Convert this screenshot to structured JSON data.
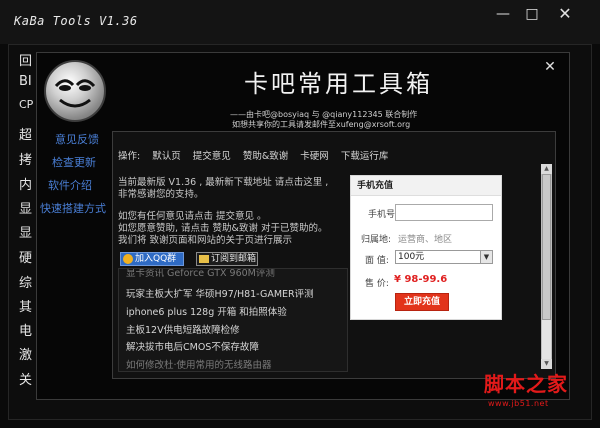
{
  "app": {
    "title": "KaBa Tools V1.36",
    "minimize": "—",
    "maximize": "□",
    "close": "✕"
  },
  "sidebar": {
    "items": [
      "回",
      "BI",
      "CP",
      "超",
      "拷",
      "内",
      "显",
      "显",
      "硬",
      "综",
      "其",
      "电",
      "激",
      "关"
    ]
  },
  "popup": {
    "close": "✕",
    "title": "卡吧常用工具箱",
    "credit_line1": "——由卡吧@bosyiaq 与 @qiany112345 联合制作",
    "credit_line2": "如想共享你的工具请发邮件至xufeng@xrsoft.org",
    "side_links": [
      "意见反馈",
      "检查更新",
      "软件介绍",
      "快速搭建方式"
    ]
  },
  "content": {
    "menu_label": "操作:",
    "menu_items": [
      "默认页",
      "提交意见",
      "赞助&致谢",
      "卡硬网",
      "下载运行库"
    ],
    "lines": [
      "当前最新版 V1.36 ,   最新新下载地址 请点击这里 ,",
      "非常感谢您的支持。",
      "如您有任何意见请点击  提交意见 。",
      "如您愿意赞助, 请点击 赞助&致谢 对于已赞助的。",
      "我们将 致谢页面和网站的关于页进行展示"
    ],
    "qq_button": "加入QQ群",
    "mail_button": "订阅到邮箱"
  },
  "news": {
    "items": [
      "显卡资讯 Geforce GTX 960M评测",
      "玩家主板大扩军 华硕H97/H81-GAMER评测",
      "iphone6 plus 128g 开箱 和拍照体验",
      "主板12V供电短路故障检修",
      "解决拔市电后CMOS不保存故障",
      "如何修改杜·使用常用的无线路由器"
    ]
  },
  "recharge": {
    "header": "手机充值",
    "phone_label": "手机号:",
    "region_label": "归属地:",
    "region_hint": "运营商、地区",
    "amount_label": "面  值:",
    "amount_selected": "100元",
    "price_label": "售  价:",
    "price_value": "¥ 98-99.6",
    "submit": "立即充值"
  },
  "watermark": {
    "main": "脚本之家",
    "url": "www.jb51.net"
  }
}
